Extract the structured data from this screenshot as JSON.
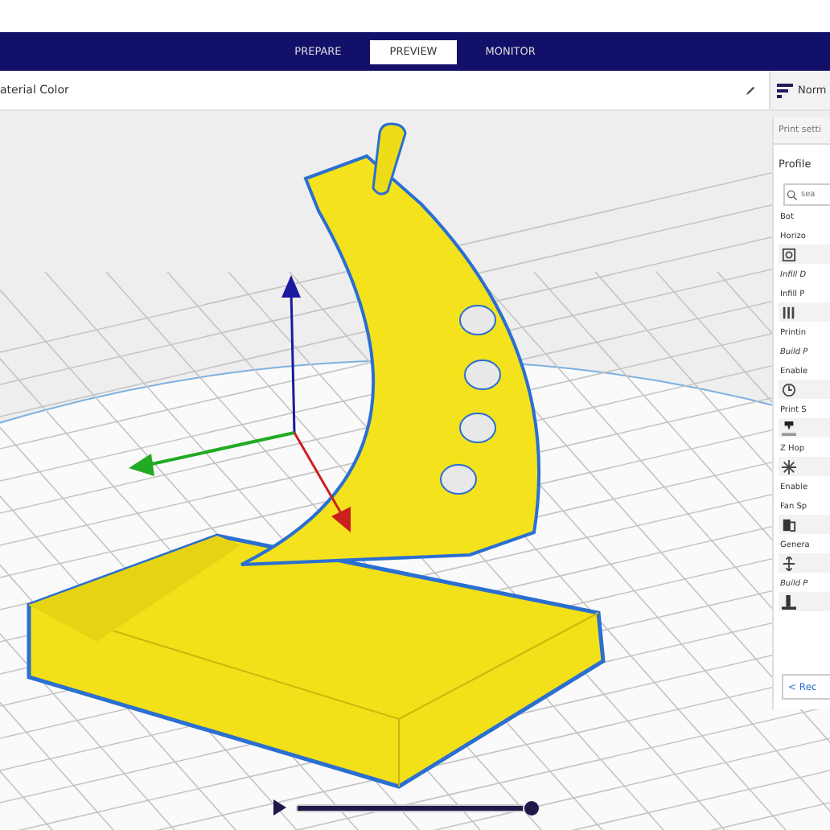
{
  "stages": [
    {
      "label": "PREPARE",
      "selected": false
    },
    {
      "label": "PREVIEW",
      "selected": true
    },
    {
      "label": "MONITOR",
      "selected": false
    }
  ],
  "view": {
    "color_scheme": "aterial Color",
    "profile_label": "Norm"
  },
  "print_settings": {
    "title": "Print setti",
    "section": "Profile",
    "search": {
      "placeholder": "sea"
    },
    "items": [
      {
        "kind": "text",
        "label": "Bot",
        "italic": false
      },
      {
        "kind": "text",
        "label": "Horizo",
        "italic": false
      },
      {
        "kind": "icon"
      },
      {
        "kind": "text",
        "label": "Infill D",
        "italic": true
      },
      {
        "kind": "text",
        "label": "Infill P",
        "italic": false
      },
      {
        "kind": "icon"
      },
      {
        "kind": "text",
        "label": "Printin",
        "italic": false
      },
      {
        "kind": "text",
        "label": "Build P",
        "italic": true
      },
      {
        "kind": "text",
        "label": "Enable",
        "italic": false
      },
      {
        "kind": "icon"
      },
      {
        "kind": "text",
        "label": "Print S",
        "italic": false
      },
      {
        "kind": "icon"
      },
      {
        "kind": "text",
        "label": "Z Hop",
        "italic": false
      },
      {
        "kind": "icon"
      },
      {
        "kind": "text",
        "label": "Enable",
        "italic": false
      },
      {
        "kind": "text",
        "label": "Fan Sp",
        "italic": false
      },
      {
        "kind": "icon"
      },
      {
        "kind": "text",
        "label": "Genera",
        "italic": false
      },
      {
        "kind": "icon"
      },
      {
        "kind": "text",
        "label": "Build P",
        "italic": true
      },
      {
        "kind": "icon"
      }
    ],
    "back_button": {
      "arrow": "<",
      "label": "Rec"
    }
  },
  "layer_slider": {
    "level": 1
  }
}
